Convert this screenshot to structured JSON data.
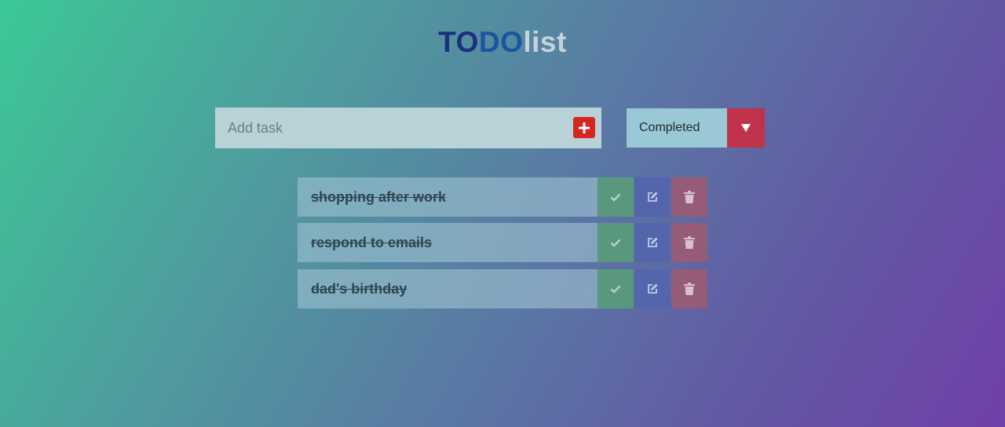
{
  "header": {
    "title_part1": "TO",
    "title_part2": "DO",
    "title_part3": "list"
  },
  "add_task": {
    "placeholder": "Add task",
    "value": "",
    "button_icon": "plus-icon"
  },
  "filter": {
    "selected": "Completed",
    "arrow_icon": "caret-down-icon"
  },
  "todos": [
    {
      "text": "shopping after work",
      "completed": true
    },
    {
      "text": "respond to emails",
      "completed": true
    },
    {
      "text": "dad's birthday",
      "completed": true
    }
  ],
  "row_icons": {
    "complete": "check-icon",
    "edit": "edit-icon",
    "delete": "trash-icon"
  },
  "colors": {
    "add_button": "#d7261f",
    "filter_arrow": "#c1334a",
    "check_button": "#5a987e",
    "edit_button": "#5366ac",
    "delete_button": "#945c78"
  }
}
